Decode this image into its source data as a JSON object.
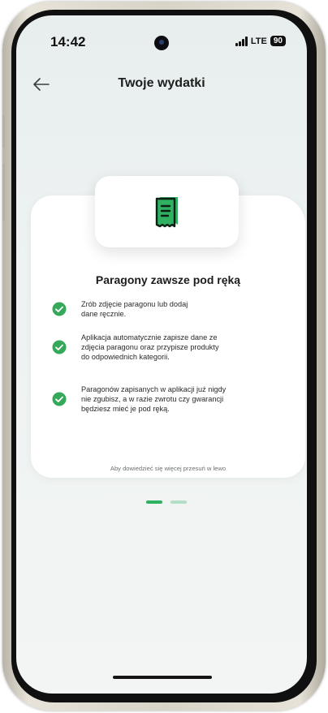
{
  "status_bar": {
    "time": "14:42",
    "network": "LTE",
    "battery": "90"
  },
  "header": {
    "back_icon": "arrow-left-icon",
    "title": "Twoje wydatki"
  },
  "card": {
    "icon": "receipt-icon",
    "title": "Paragony zawsze pod ręką",
    "features": [
      {
        "icon": "check-circle-icon",
        "text": "Zrób zdjęcie paragonu lub dodaj\ndane ręcznie."
      },
      {
        "icon": "check-circle-icon",
        "text": "Aplikacja automatycznie zapisze dane ze\nzdjęcia paragonu oraz przypisze produkty\ndo odpowiednich kategorii."
      },
      {
        "icon": "check-circle-icon",
        "text": "Paragonów zapisanych w aplikacji już nigdy\nnie zgubisz, a w razie zwrotu czy gwarancji\nbędziesz mieć je pod ręką."
      }
    ],
    "swipe_hint": "Aby dowiedzieć się więcej przesuń w lewo"
  },
  "pager": {
    "pages": 2,
    "active_page": 1
  },
  "colors": {
    "accent_green": "#2fb161",
    "check_green": "#36a85a",
    "pager_active": "#2fb161",
    "pager_inactive": "#b3dfc6",
    "background": "#eef2f2",
    "card": "#ffffff"
  }
}
